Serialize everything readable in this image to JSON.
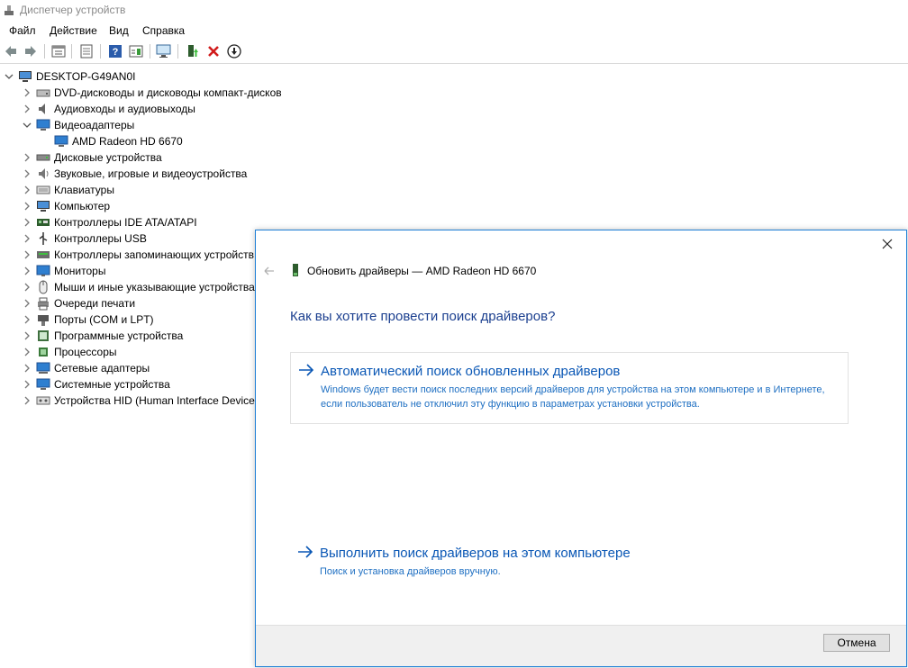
{
  "window": {
    "title": "Диспетчер устройств"
  },
  "menu": {
    "items": [
      "Файл",
      "Действие",
      "Вид",
      "Справка"
    ]
  },
  "tree": {
    "root": "DESKTOP-G49AN0I",
    "nodes": [
      {
        "label": "DVD-дисководы и дисководы компакт-дисков",
        "icon": "dvd-drive-icon",
        "expanded": false
      },
      {
        "label": "Аудиовходы и аудиовыходы",
        "icon": "audio-speaker-icon",
        "expanded": false
      },
      {
        "label": "Видеоадаптеры",
        "icon": "display-adapter-icon",
        "expanded": true
      },
      {
        "label": "AMD Radeon HD 6670",
        "icon": "display-adapter-icon",
        "child": true
      },
      {
        "label": "Дисковые устройства",
        "icon": "disk-drive-icon",
        "expanded": false
      },
      {
        "label": "Звуковые, игровые и видеоустройства",
        "icon": "sound-device-icon",
        "expanded": false
      },
      {
        "label": "Клавиатуры",
        "icon": "keyboard-icon",
        "expanded": false
      },
      {
        "label": "Компьютер",
        "icon": "computer-icon",
        "expanded": false
      },
      {
        "label": "Контроллеры IDE ATA/ATAPI",
        "icon": "ide-controller-icon",
        "expanded": false
      },
      {
        "label": "Контроллеры USB",
        "icon": "usb-controller-icon",
        "expanded": false
      },
      {
        "label": "Контроллеры запоминающих устройств",
        "icon": "storage-controller-icon",
        "expanded": false
      },
      {
        "label": "Мониторы",
        "icon": "monitor-icon",
        "expanded": false
      },
      {
        "label": "Мыши и иные указывающие устройства",
        "icon": "mouse-icon",
        "expanded": false
      },
      {
        "label": "Очереди печати",
        "icon": "printer-icon",
        "expanded": false
      },
      {
        "label": "Порты (COM и LPT)",
        "icon": "port-icon",
        "expanded": false
      },
      {
        "label": "Программные устройства",
        "icon": "software-device-icon",
        "expanded": false
      },
      {
        "label": "Процессоры",
        "icon": "processor-icon",
        "expanded": false
      },
      {
        "label": "Сетевые адаптеры",
        "icon": "network-adapter-icon",
        "expanded": false
      },
      {
        "label": "Системные устройства",
        "icon": "system-device-icon",
        "expanded": false
      },
      {
        "label": "Устройства HID (Human Interface Devices)",
        "icon": "hid-icon",
        "expanded": false
      }
    ]
  },
  "dialog": {
    "header": "Обновить драйверы — AMD Radeon HD 6670",
    "question": "Как вы хотите провести поиск драйверов?",
    "option_auto": {
      "title": "Автоматический поиск обновленных драйверов",
      "desc": "Windows будет вести поиск последних версий драйверов для устройства на этом компьютере и в Интернете, если пользователь не отключил эту функцию в параметрах установки устройства."
    },
    "option_manual": {
      "title": "Выполнить поиск драйверов на этом компьютере",
      "desc": "Поиск и установка драйверов вручную."
    },
    "cancel": "Отмена"
  },
  "colors": {
    "accent": "#0a57b5",
    "question": "#1b3f8f",
    "border": "#1e7fd6",
    "footer": "#f0f0f0"
  }
}
